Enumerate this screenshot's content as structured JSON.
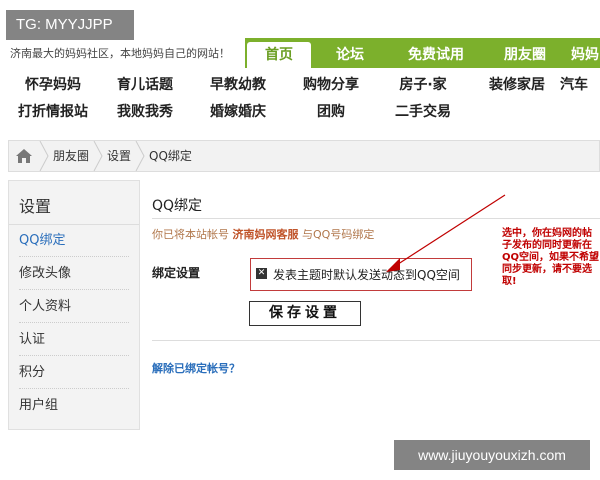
{
  "watermark_top": "TG: MYYJJPP",
  "header": {
    "slogan": "济南最大的妈妈社区，本地妈妈自己的网站！",
    "nav_tabs": [
      "首页",
      "论坛",
      "免费试用",
      "朋友圈",
      "妈妈"
    ]
  },
  "categories": {
    "row1": [
      "怀孕妈妈",
      "育儿话题",
      "早教幼教",
      "购物分享",
      "房子·家",
      "装修家居",
      "汽车"
    ],
    "row2": [
      "打折情报站",
      "我败我秀",
      "婚嫁婚庆",
      "团购",
      "二手交易"
    ]
  },
  "breadcrumb": {
    "items": [
      "朋友圈",
      "设置",
      "QQ绑定"
    ]
  },
  "sidebar": {
    "title": "设置",
    "items": [
      "QQ绑定",
      "修改头像",
      "个人资料",
      "认证",
      "积分",
      "用户组"
    ]
  },
  "main": {
    "title": "QQ绑定",
    "note_prefix": "你已将本站帐号",
    "note_account": "济南妈网客服",
    "note_suffix": "与QQ号码绑定",
    "bind_label": "绑定设置",
    "checkbox_label": "发表主题时默认发送动态到QQ空间",
    "checkbox_checked": true,
    "save_button": "保存设置",
    "unbind_link": "解除已绑定帐号？"
  },
  "annotation": "选中，你在妈网的帖子发布的同时更新在QQ空间，如果不希望同步更新，请不要选取!",
  "watermark_bottom": "www.jiuyouyouxizh.com",
  "colors": {
    "green_nav": "#7cb02c",
    "link_blue": "#2a6ebb",
    "annotation_red": "#c00000"
  }
}
